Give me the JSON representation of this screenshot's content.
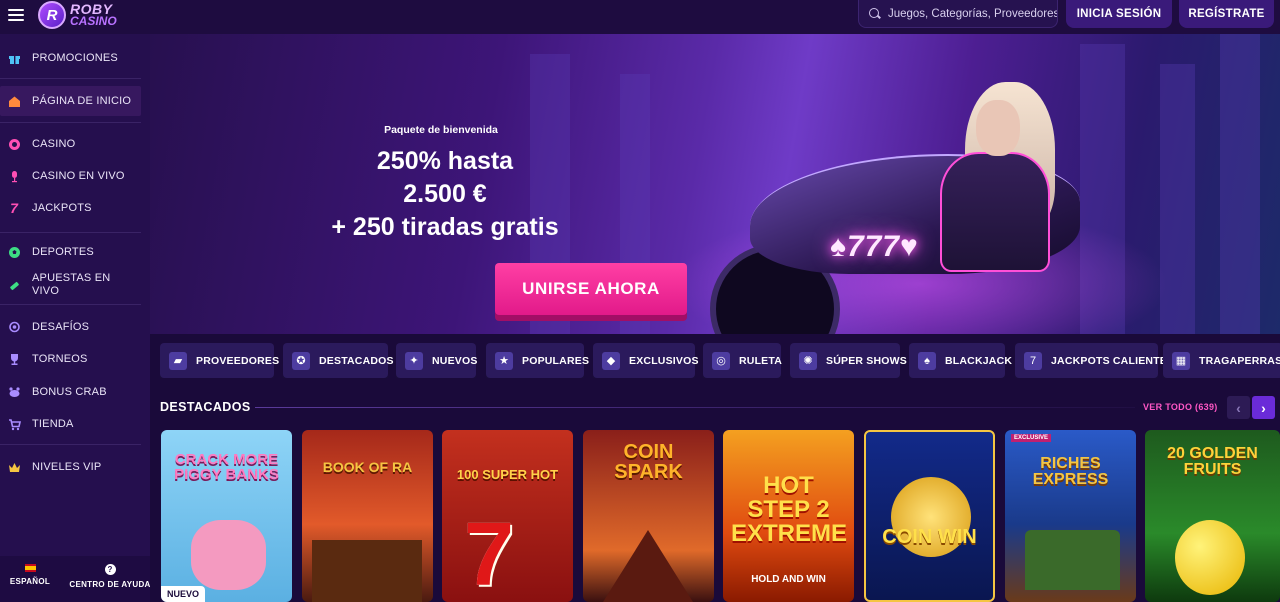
{
  "header": {
    "logo_line1": "ROBY",
    "logo_line2": "CASINO",
    "logo_mark": "R",
    "search_placeholder": "Juegos, Categorías, Proveedores",
    "login_label": "INICIA SESIÓN",
    "register_label": "REGÍSTRATE"
  },
  "sidebar": {
    "items": [
      {
        "label": "PROMOCIONES",
        "icon": "gift-icon",
        "color": "#4fc3f7"
      },
      {
        "label": "PÁGINA DE INICIO",
        "icon": "home-icon",
        "color": "#ff8a3d"
      },
      {
        "label": "CASINO",
        "icon": "casino-chip-icon",
        "color": "#ff4fb4"
      },
      {
        "label": "CASINO EN VIVO",
        "icon": "microphone-icon",
        "color": "#ff4fb4"
      },
      {
        "label": "JACKPOTS",
        "icon": "seven-icon",
        "color": "#ff4fb4"
      },
      {
        "label": "DEPORTES",
        "icon": "soccer-ball-icon",
        "color": "#3ddc84"
      },
      {
        "label": "APUESTAS EN VIVO",
        "icon": "live-bet-icon",
        "color": "#3ddc84"
      },
      {
        "label": "DESAFÍOS",
        "icon": "medal-icon",
        "color": "#a98cff"
      },
      {
        "label": "TORNEOS",
        "icon": "trophy-icon",
        "color": "#a98cff"
      },
      {
        "label": "BONUS CRAB",
        "icon": "crab-icon",
        "color": "#a98cff"
      },
      {
        "label": "TIENDA",
        "icon": "cart-icon",
        "color": "#a98cff"
      },
      {
        "label": "NIVELES VIP",
        "icon": "crown-icon",
        "color": "#f5c542"
      }
    ],
    "language_label": "ESPAÑOL",
    "help_label": "CENTRO DE AYUDA"
  },
  "hero": {
    "kicker": "Paquete de bienvenida",
    "title_line1": "250% hasta",
    "title_line2": "2.500 €",
    "title_line3": "+ 250 tiradas gratis",
    "cta_label": "UNIRSE AHORA",
    "plate_text": "♠777♥"
  },
  "categories": [
    {
      "label": "PROVEEDORES",
      "icon": "folder-icon"
    },
    {
      "label": "DESTACADOS",
      "icon": "ribbon-icon"
    },
    {
      "label": "NUEVOS",
      "icon": "sparkle-icon"
    },
    {
      "label": "POPULARES",
      "icon": "star-icon"
    },
    {
      "label": "EXCLUSIVOS",
      "icon": "diamond-icon"
    },
    {
      "label": "RULETA",
      "icon": "roulette-icon"
    },
    {
      "label": "SÚPER SHOWS",
      "icon": "wheel-show-icon"
    },
    {
      "label": "BLACKJACK",
      "icon": "spade-icon"
    },
    {
      "label": "JACKPOTS CALIENTES",
      "icon": "seven-icon"
    },
    {
      "label": "TRAGAPERRAS",
      "icon": "slot-icon"
    }
  ],
  "featured": {
    "title": "DESTACADOS",
    "see_all_label": "VER TODO (639)",
    "prev_label": "‹",
    "next_label": "›",
    "games": [
      {
        "title": "CRACK MORE PIGGY BANKS",
        "badge": "NUEVO",
        "bg": "#7ec8f0",
        "accent": "#ff6fb0"
      },
      {
        "title": "BOOK OF RA",
        "badge": "",
        "bg": "#a5281a",
        "accent": "#f5c542"
      },
      {
        "title": "100 SUPER HOT",
        "badge": "",
        "bg": "#c3301e",
        "accent": "#ffd24a"
      },
      {
        "title": "COIN SPARK",
        "badge": "",
        "bg": "#8a1f1a",
        "accent": "#ffb42a"
      },
      {
        "title": "HOT STEP 2 EXTREME",
        "badge": "HOLD AND WIN",
        "bg": "#e04a10",
        "accent": "#ffe04a"
      },
      {
        "title": "COIN WIN",
        "badge": "",
        "bg": "#122a8a",
        "accent": "#f5c542"
      },
      {
        "title": "RICHES EXPRESS",
        "badge": "EXCLUSIVE",
        "bg": "#1f4aa8",
        "accent": "#f5c542"
      },
      {
        "title": "20 GOLDEN FRUITS",
        "badge": "",
        "bg": "#2a8a2a",
        "accent": "#ffd23a"
      }
    ]
  }
}
